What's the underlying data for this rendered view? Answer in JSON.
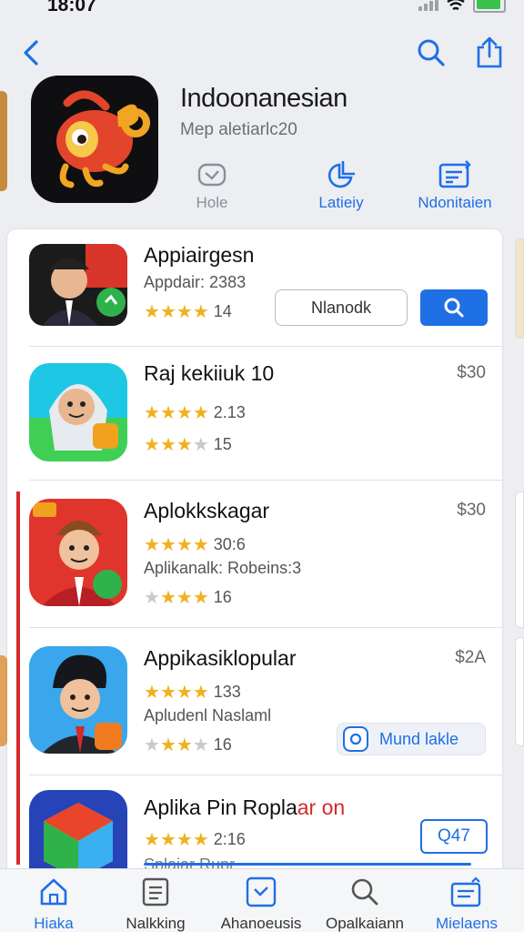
{
  "status_bar": {
    "time": "18:07"
  },
  "header": {
    "title": "Indoonanesian",
    "subtitle": "Mep aletiarlc20",
    "actions": [
      {
        "label": "Hole",
        "icon": "mail-icon"
      },
      {
        "label": "Latieiy",
        "icon": "chart-icon"
      },
      {
        "label": "Ndonitaien",
        "icon": "calendar-icon"
      }
    ]
  },
  "apps": [
    {
      "name": "Appiairgesn",
      "line1": "Appdair: 2383",
      "rating_count": "14",
      "stars": 3.5,
      "secondary_button": "Nlanodk",
      "primary_button_icon": "search-icon"
    },
    {
      "name": "Raj kekiiuk 10",
      "price": "$30",
      "rating_a": "2.13",
      "stars_a": 3.5,
      "rating_b": "15",
      "stars_b": 3.5
    },
    {
      "name": "Aplokkskagar",
      "price": "$30",
      "rating_a": "30:6",
      "stars_a": 3.5,
      "line2": "Aplikanalk: Robeins:3",
      "rating_b": "16",
      "stars_b": 3.5
    },
    {
      "name": "Appikasiklopular",
      "price": "$2A",
      "rating_a": "133",
      "stars_a": 3.5,
      "line2": "Apludenl Naslaml",
      "rating_b": "16",
      "stars_b": 3,
      "button": "Mund lakle"
    },
    {
      "name_main": "Aplika Pin Ropla",
      "name_accent": "ar on",
      "rating_a": "2:16",
      "stars_a": 3.5,
      "line2": "Splaiar Rupr",
      "button": "Q47"
    }
  ],
  "tabs": [
    {
      "label": "Hiaka",
      "icon": "home-icon",
      "active": true
    },
    {
      "label": "Nalkking",
      "icon": "list-icon",
      "active": false
    },
    {
      "label": "Ahanoeusis",
      "icon": "apps-icon",
      "active": false
    },
    {
      "label": "Opalkaiann",
      "icon": "search-icon",
      "active": false
    },
    {
      "label": "Mielaens",
      "icon": "updates-icon",
      "active": false
    }
  ],
  "colors": {
    "accent": "#1f6fe5",
    "star": "#f2b01e",
    "accent_red": "#d62a2a"
  }
}
